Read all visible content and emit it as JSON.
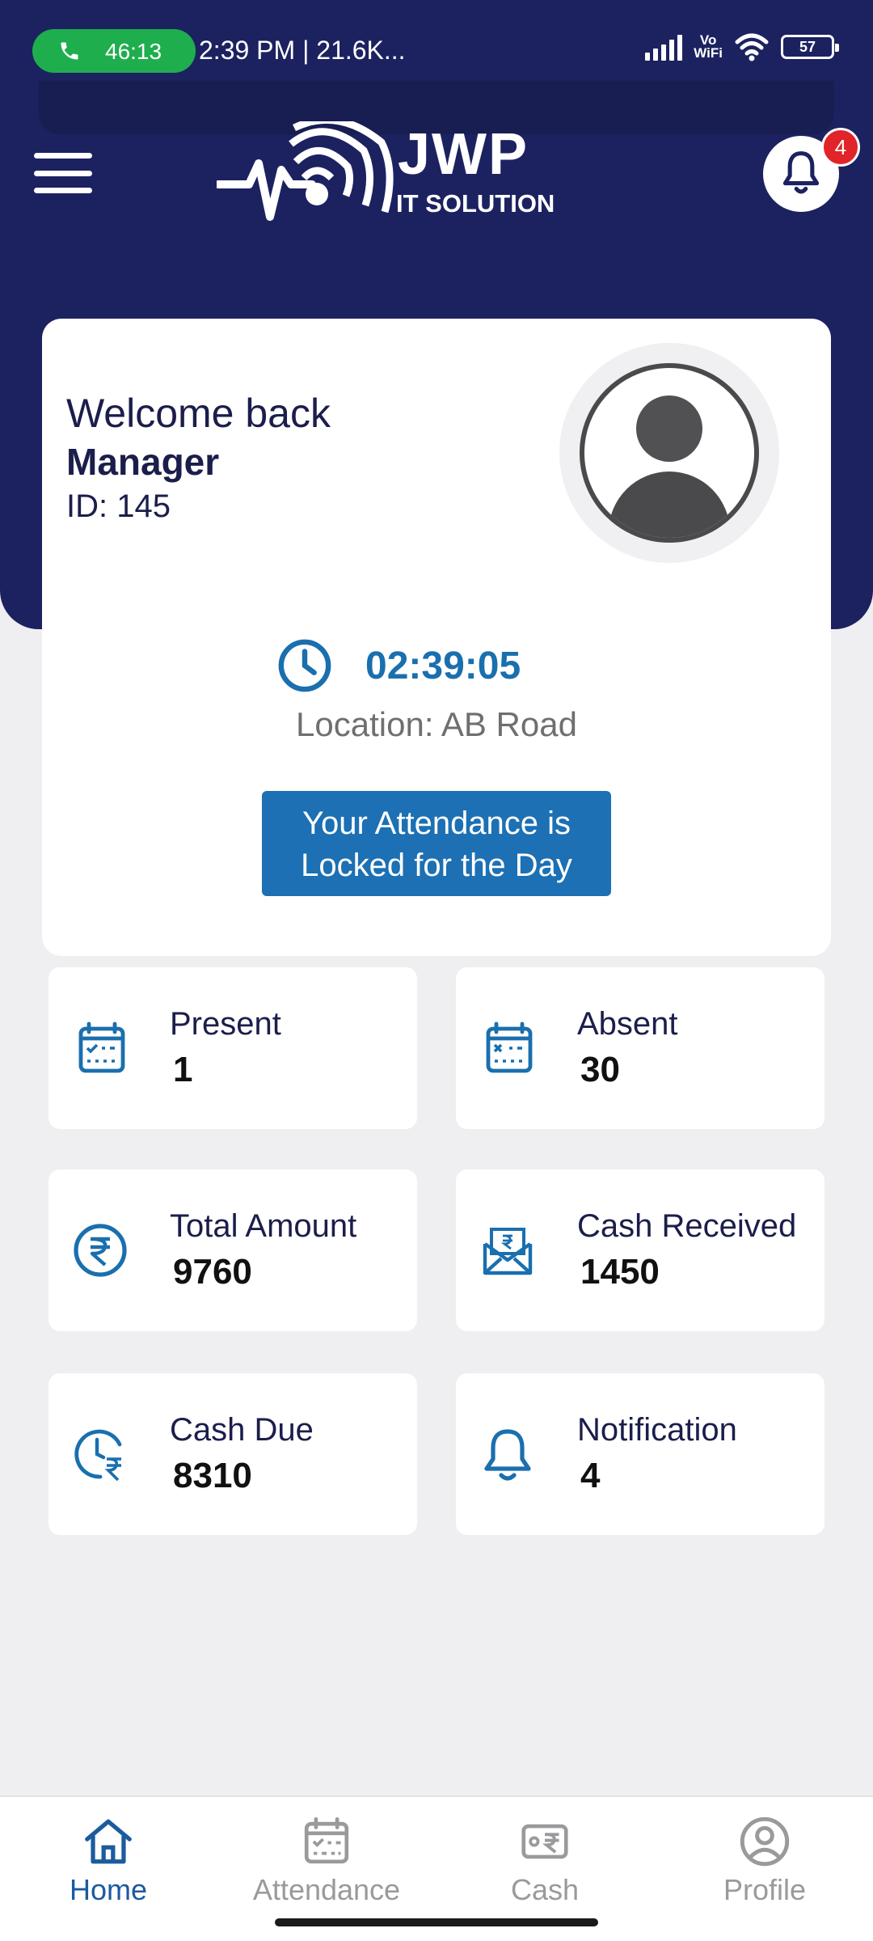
{
  "status_bar": {
    "call_timer": "46:13",
    "time_info": "2:39 PM | 21.6K...",
    "network_label_top": "Vo",
    "network_label_bottom": "WiFi",
    "battery": "57"
  },
  "header": {
    "logo_title": "JWP",
    "logo_subtitle": "IT SOLUTION",
    "notification_badge": "4"
  },
  "welcome": {
    "greeting": "Welcome back",
    "name": "Manager",
    "employee_id": "ID: 145",
    "clock_time": "02:39:05",
    "location": "Location: AB Road",
    "attendance_line1": "Your Attendance is",
    "attendance_line2": "Locked for the Day"
  },
  "stats": [
    {
      "label": "Present",
      "value": "1",
      "icon": "calendar-check-icon"
    },
    {
      "label": "Absent",
      "value": "30",
      "icon": "calendar-cross-icon"
    },
    {
      "label": "Total Amount",
      "value": "9760",
      "icon": "rupee-circle-icon"
    },
    {
      "label": "Cash Received",
      "value": "1450",
      "icon": "cash-envelope-icon"
    },
    {
      "label": "Cash Due",
      "value": "8310",
      "icon": "clock-rupee-icon"
    },
    {
      "label": "Notification",
      "value": "4",
      "icon": "bell-icon"
    }
  ],
  "bottom_nav": [
    {
      "label": "Home",
      "active": true
    },
    {
      "label": "Attendance",
      "active": false
    },
    {
      "label": "Cash",
      "active": false
    },
    {
      "label": "Profile",
      "active": false
    }
  ],
  "colors": {
    "header_bg": "#1c2260",
    "accent": "#1c70b3",
    "icon_blue": "#1a6fae",
    "badge_red": "#e0242a",
    "call_green": "#1fae4e"
  }
}
